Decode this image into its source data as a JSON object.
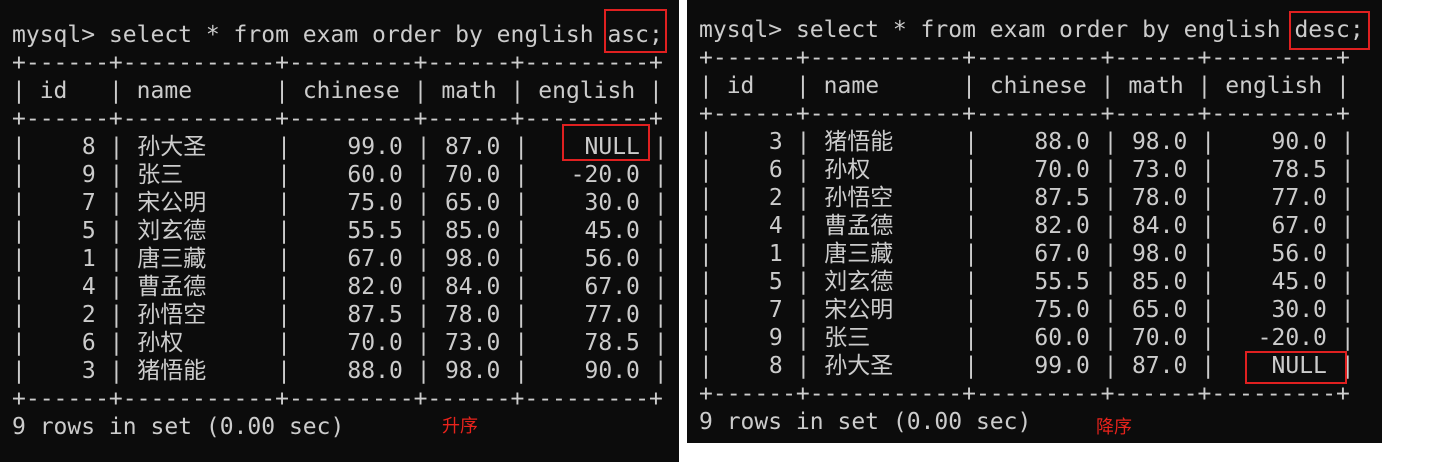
{
  "panels": [
    {
      "prompt": "mysql> ",
      "query": "select * from exam order by english ",
      "order_kw": "asc",
      "semicolon": ";",
      "headers": [
        "id",
        "name",
        "chinese",
        "math",
        "english"
      ],
      "rows": [
        [
          "8",
          "孙大圣",
          "99.0",
          "87.0",
          "NULL"
        ],
        [
          "9",
          "张三",
          "60.0",
          "70.0",
          "-20.0"
        ],
        [
          "7",
          "宋公明",
          "75.0",
          "65.0",
          "30.0"
        ],
        [
          "5",
          "刘玄德",
          "55.5",
          "85.0",
          "45.0"
        ],
        [
          "1",
          "唐三藏",
          "67.0",
          "98.0",
          "56.0"
        ],
        [
          "4",
          "曹孟德",
          "82.0",
          "84.0",
          "67.0"
        ],
        [
          "2",
          "孙悟空",
          "87.5",
          "78.0",
          "77.0"
        ],
        [
          "6",
          "孙权",
          "70.0",
          "73.0",
          "78.5"
        ],
        [
          "3",
          "猪悟能",
          "88.0",
          "98.0",
          "90.0"
        ]
      ],
      "footer": "9 rows in set (0.00 sec)",
      "caption": "升序"
    },
    {
      "prompt": "mysql> ",
      "query": "select * from exam order by english ",
      "order_kw": "desc;",
      "semicolon": "",
      "headers": [
        "id",
        "name",
        "chinese",
        "math",
        "english"
      ],
      "rows": [
        [
          "3",
          "猪悟能",
          "88.0",
          "98.0",
          "90.0"
        ],
        [
          "6",
          "孙权",
          "70.0",
          "73.0",
          "78.5"
        ],
        [
          "2",
          "孙悟空",
          "87.5",
          "78.0",
          "77.0"
        ],
        [
          "4",
          "曹孟德",
          "82.0",
          "84.0",
          "67.0"
        ],
        [
          "1",
          "唐三藏",
          "67.0",
          "98.0",
          "56.0"
        ],
        [
          "5",
          "刘玄德",
          "55.5",
          "85.0",
          "45.0"
        ],
        [
          "7",
          "宋公明",
          "75.0",
          "65.0",
          "30.0"
        ],
        [
          "9",
          "张三",
          "60.0",
          "70.0",
          "-20.0"
        ],
        [
          "8",
          "孙大圣",
          "99.0",
          "87.0",
          "NULL"
        ]
      ],
      "footer": "9 rows in set (0.00 sec)",
      "caption": "降序"
    }
  ],
  "colors": {
    "terminal_bg": "#0c0c0c",
    "terminal_text": "#cccccc",
    "highlight_box": "#e02020",
    "caption": "#e8231c"
  }
}
